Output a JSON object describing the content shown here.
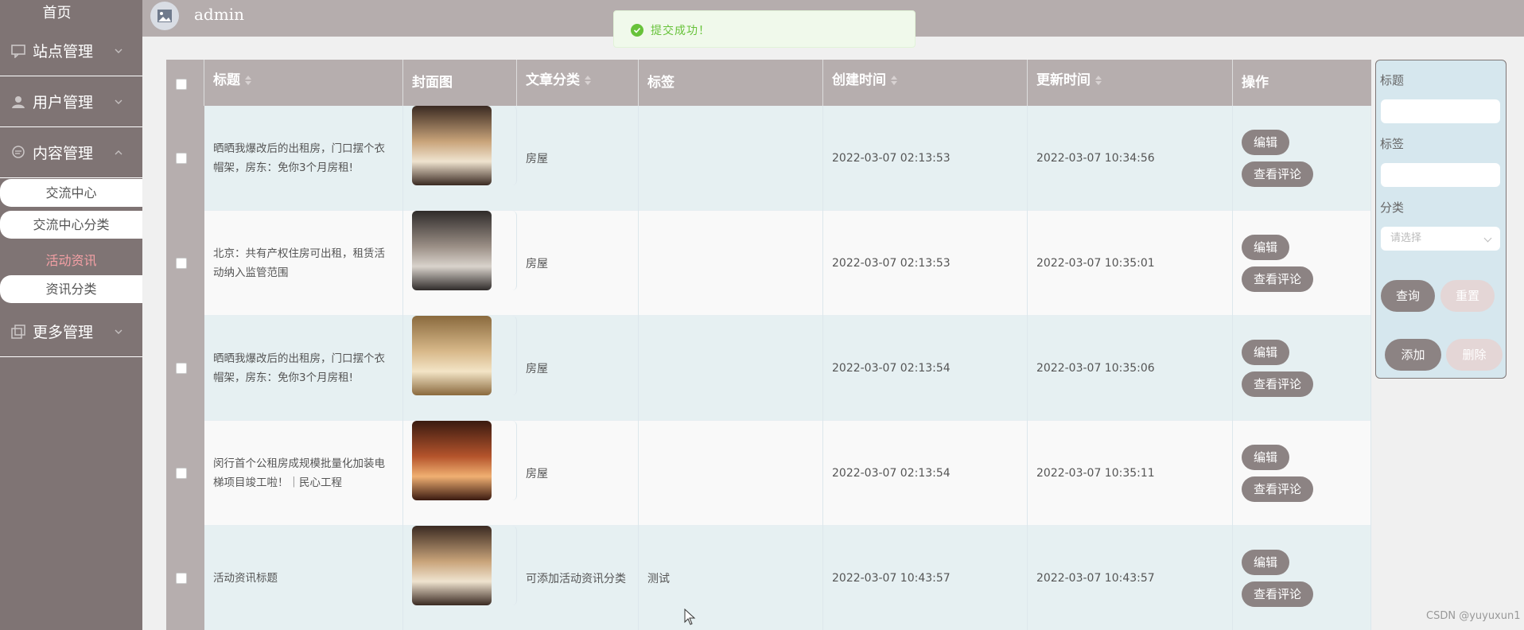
{
  "sidebar": {
    "home": "首页",
    "groups": [
      {
        "label": "站点管理",
        "icon": "chat-icon"
      },
      {
        "label": "用户管理",
        "icon": "user-icon"
      },
      {
        "label": "内容管理",
        "icon": "message-icon"
      },
      {
        "label": "更多管理",
        "icon": "copy-icon"
      }
    ],
    "sub_items": [
      "交流中心",
      "交流中心分类",
      "活动资讯",
      "资讯分类"
    ],
    "active_sub": "活动资讯"
  },
  "header": {
    "user": "admin"
  },
  "toast": {
    "message": "提交成功！",
    "type": "success"
  },
  "table": {
    "columns": [
      "标题",
      "封面图",
      "文章分类",
      "标签",
      "创建时间",
      "更新时间",
      "操作"
    ],
    "rows": [
      {
        "title": "晒晒我爆改后的出租房，门口摆个衣帽架，房东：免你3个月房租!",
        "category": "房屋",
        "tag": "",
        "created": "2022-03-07 02:13:53",
        "updated": "2022-03-07 10:34:56"
      },
      {
        "title": "北京：共有产权住房可出租，租赁活动纳入监管范围",
        "category": "房屋",
        "tag": "",
        "created": "2022-03-07 02:13:53",
        "updated": "2022-03-07 10:35:01"
      },
      {
        "title": "晒晒我爆改后的出租房，门口摆个衣帽架，房东：免你3个月房租!",
        "category": "房屋",
        "tag": "",
        "created": "2022-03-07 02:13:54",
        "updated": "2022-03-07 10:35:06"
      },
      {
        "title": "闵行首个公租房成规模批量化加装电梯项目竣工啦！｜民心工程",
        "category": "房屋",
        "tag": "",
        "created": "2022-03-07 02:13:54",
        "updated": "2022-03-07 10:35:11"
      },
      {
        "title": "活动资讯标题",
        "category": "可添加活动资讯分类",
        "tag": "测试",
        "created": "2022-03-07 10:43:57",
        "updated": "2022-03-07 10:43:57"
      }
    ],
    "edit_label": "编辑",
    "comments_label": "查看评论"
  },
  "search": {
    "title_label": "标题",
    "title_value": "",
    "tag_label": "标签",
    "tag_value": "",
    "category_label": "分类",
    "category_placeholder": "请选择",
    "query_label": "查询",
    "reset_label": "重置",
    "add_label": "添加",
    "delete_label": "删除"
  },
  "watermark": "CSDN @yuyuxun1",
  "colors": {
    "sidebar": "#7f7474",
    "header": "#b5adad",
    "button": "#8c8383",
    "active_text": "#f4a0a5",
    "panel": "#d6e7ee",
    "success": "#67c23a"
  }
}
